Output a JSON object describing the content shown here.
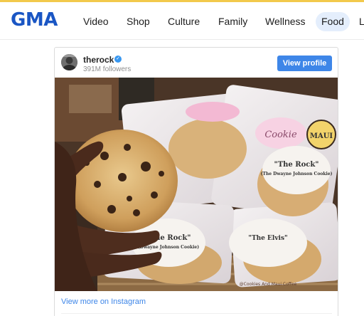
{
  "site": {
    "logo": "GMA",
    "nav": [
      {
        "label": "Video"
      },
      {
        "label": "Shop"
      },
      {
        "label": "Culture"
      },
      {
        "label": "Family"
      },
      {
        "label": "Wellness"
      },
      {
        "label": "Food",
        "active": true
      }
    ],
    "nav_overflow": "L"
  },
  "instagram_embed": {
    "username": "therock",
    "verified": true,
    "followers": "391M followers",
    "view_profile_label": "View profile",
    "view_more_label": "View more on Instagram",
    "photo": {
      "labels": {
        "cookie_top_title": "\"The Rock\"",
        "cookie_top_subtitle": "(The Dwayne Johnson Cookie)",
        "cookie_bottom_left_title": "\"The Rock\"",
        "cookie_bottom_left_subtitle": "(Dwayne Johnson Cookie)",
        "cookie_bottom_right_title": "\"The Elvis\"",
        "maui_badge": "MAUI",
        "cookie_script": "Cookie",
        "watermark": "@Cookies And Maui Coffee"
      }
    }
  },
  "colors": {
    "brand_blue": "#1a56c4",
    "active_pill": "#e4eefc",
    "instagram_button": "#3e86e8",
    "verified_badge": "#3897f0",
    "accent_yellow": "#f2c94c"
  }
}
